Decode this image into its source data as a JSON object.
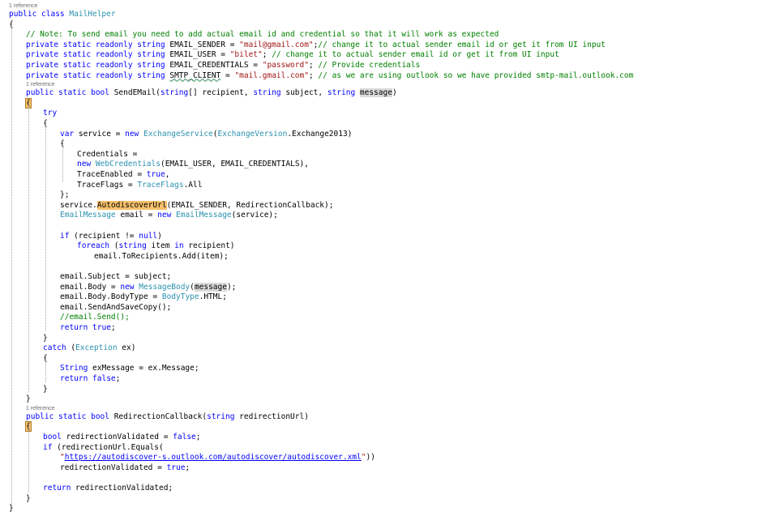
{
  "code": {
    "lines": [
      {
        "kind": "ref",
        "text": "1 reference"
      },
      {
        "kind": "code",
        "indent": 0,
        "tokens": [
          [
            "k",
            "public "
          ],
          [
            "k",
            "class "
          ],
          [
            "t",
            "MailHelper"
          ]
        ]
      },
      {
        "kind": "code",
        "indent": 0,
        "tokens": [
          [
            "p",
            "{"
          ]
        ]
      },
      {
        "kind": "code",
        "indent": 1,
        "tokens": [
          [
            "c",
            "// Note: To send email you need to add actual email id and credential so that it will work as expected"
          ]
        ]
      },
      {
        "kind": "code",
        "indent": 1,
        "tokens": [
          [
            "k",
            "private "
          ],
          [
            "k",
            "static "
          ],
          [
            "k",
            "readonly "
          ],
          [
            "k",
            "string "
          ],
          [
            "p",
            "EMAIL_SENDER = "
          ],
          [
            "s",
            "\"mail@gmail.com\""
          ],
          [
            "p",
            ";"
          ],
          [
            "c",
            "// change it to actual sender email id or get it from UI input"
          ]
        ]
      },
      {
        "kind": "code",
        "indent": 1,
        "tokens": [
          [
            "k",
            "private "
          ],
          [
            "k",
            "static "
          ],
          [
            "k",
            "readonly "
          ],
          [
            "k",
            "string "
          ],
          [
            "p",
            "EMAIL_USER = "
          ],
          [
            "s",
            "\"bilet\""
          ],
          [
            "p",
            "; "
          ],
          [
            "c",
            "// change it to actual sender email id or get it from UI input"
          ]
        ]
      },
      {
        "kind": "code",
        "indent": 1,
        "tokens": [
          [
            "k",
            "private "
          ],
          [
            "k",
            "static "
          ],
          [
            "k",
            "readonly "
          ],
          [
            "k",
            "string "
          ],
          [
            "p",
            "EMAIL_CREDENTIALS = "
          ],
          [
            "s",
            "\"password\""
          ],
          [
            "p",
            "; "
          ],
          [
            "c",
            "// Provide credentials"
          ]
        ]
      },
      {
        "kind": "code",
        "indent": 1,
        "tokens": [
          [
            "k",
            "private "
          ],
          [
            "k",
            "static "
          ],
          [
            "k",
            "readonly "
          ],
          [
            "k",
            "string "
          ],
          [
            "sq",
            "SMTP_CLIENT"
          ],
          [
            "p",
            " = "
          ],
          [
            "s",
            "\"mail.gmail.com\""
          ],
          [
            "p",
            "; "
          ],
          [
            "c",
            "// as we are using outlook so we have provided smtp-mail.outlook.com"
          ]
        ]
      },
      {
        "kind": "ref",
        "text": "1 reference"
      },
      {
        "kind": "code",
        "indent": 1,
        "tokens": [
          [
            "k",
            "public "
          ],
          [
            "k",
            "static "
          ],
          [
            "k",
            "bool "
          ],
          [
            "p",
            "SendEMail("
          ],
          [
            "k",
            "string"
          ],
          [
            "p",
            "[] recipient, "
          ],
          [
            "k",
            "string "
          ],
          [
            "p",
            "subject, "
          ],
          [
            "k",
            "string "
          ],
          [
            "rc",
            "message"
          ],
          [
            "p",
            ")"
          ]
        ]
      },
      {
        "kind": "code",
        "indent": 1,
        "tokens": [
          [
            "bh",
            "{"
          ]
        ]
      },
      {
        "kind": "code",
        "indent": 2,
        "tokens": [
          [
            "k",
            "try"
          ]
        ]
      },
      {
        "kind": "code",
        "indent": 2,
        "tokens": [
          [
            "p",
            "{"
          ]
        ]
      },
      {
        "kind": "code",
        "indent": 3,
        "tokens": [
          [
            "k",
            "var "
          ],
          [
            "p",
            "service = "
          ],
          [
            "k",
            "new "
          ],
          [
            "t",
            "ExchangeService"
          ],
          [
            "p",
            "("
          ],
          [
            "t",
            "ExchangeVersion"
          ],
          [
            "p",
            ".Exchange2013)"
          ]
        ]
      },
      {
        "kind": "code",
        "indent": 3,
        "tokens": [
          [
            "p",
            "{"
          ]
        ]
      },
      {
        "kind": "code",
        "indent": 4,
        "tokens": [
          [
            "p",
            "Credentials ="
          ]
        ]
      },
      {
        "kind": "code",
        "indent": 4,
        "tokens": [
          [
            "k",
            "new "
          ],
          [
            "t",
            "WebCredentials"
          ],
          [
            "p",
            "(EMAIL_USER, EMAIL_CREDENTIALS),"
          ]
        ]
      },
      {
        "kind": "code",
        "indent": 4,
        "tokens": [
          [
            "p",
            "TraceEnabled = "
          ],
          [
            "k",
            "true"
          ],
          [
            "p",
            ","
          ]
        ]
      },
      {
        "kind": "code",
        "indent": 4,
        "tokens": [
          [
            "p",
            "TraceFlags = "
          ],
          [
            "t",
            "TraceFlags"
          ],
          [
            "p",
            ".All"
          ]
        ]
      },
      {
        "kind": "code",
        "indent": 3,
        "tokens": [
          [
            "p",
            "};"
          ]
        ]
      },
      {
        "kind": "code",
        "indent": 3,
        "tokens": [
          [
            "p",
            "service."
          ],
          [
            "hm",
            "AutodiscoverUrl"
          ],
          [
            "p",
            "(EMAIL_SENDER, RedirectionCallback);"
          ]
        ]
      },
      {
        "kind": "code",
        "indent": 3,
        "tokens": [
          [
            "t",
            "EmailMessage "
          ],
          [
            "p",
            "email = "
          ],
          [
            "k",
            "new "
          ],
          [
            "t",
            "EmailMessage"
          ],
          [
            "p",
            "(service);"
          ]
        ]
      },
      {
        "kind": "blank"
      },
      {
        "kind": "code",
        "indent": 3,
        "tokens": [
          [
            "k",
            "if "
          ],
          [
            "p",
            "(recipient != "
          ],
          [
            "k",
            "null"
          ],
          [
            "p",
            ")"
          ]
        ]
      },
      {
        "kind": "code",
        "indent": 4,
        "tokens": [
          [
            "k",
            "foreach "
          ],
          [
            "p",
            "("
          ],
          [
            "k",
            "string "
          ],
          [
            "p",
            "item "
          ],
          [
            "k",
            "in "
          ],
          [
            "p",
            "recipient)"
          ]
        ]
      },
      {
        "kind": "code",
        "indent": 5,
        "tokens": [
          [
            "p",
            "email.ToRecipients.Add(item);"
          ]
        ]
      },
      {
        "kind": "blank"
      },
      {
        "kind": "code",
        "indent": 3,
        "tokens": [
          [
            "p",
            "email.Subject = subject;"
          ]
        ]
      },
      {
        "kind": "code",
        "indent": 3,
        "tokens": [
          [
            "p",
            "email.Body = "
          ],
          [
            "k",
            "new "
          ],
          [
            "t",
            "MessageBody"
          ],
          [
            "p",
            "("
          ],
          [
            "hr",
            "message"
          ],
          [
            "p",
            ");"
          ]
        ]
      },
      {
        "kind": "code",
        "indent": 3,
        "tokens": [
          [
            "p",
            "email.Body.BodyType = "
          ],
          [
            "t",
            "BodyType"
          ],
          [
            "p",
            ".HTML;"
          ]
        ]
      },
      {
        "kind": "code",
        "indent": 3,
        "tokens": [
          [
            "p",
            "email.SendAndSaveCopy();"
          ]
        ]
      },
      {
        "kind": "code",
        "indent": 3,
        "tokens": [
          [
            "c",
            "//email.Send();"
          ]
        ]
      },
      {
        "kind": "code",
        "indent": 3,
        "tokens": [
          [
            "k",
            "return "
          ],
          [
            "k",
            "true"
          ],
          [
            "p",
            ";"
          ]
        ]
      },
      {
        "kind": "code",
        "indent": 2,
        "tokens": [
          [
            "p",
            "}"
          ]
        ]
      },
      {
        "kind": "code",
        "indent": 2,
        "tokens": [
          [
            "k",
            "catch "
          ],
          [
            "p",
            "("
          ],
          [
            "t",
            "Exception "
          ],
          [
            "p",
            "ex)"
          ]
        ]
      },
      {
        "kind": "code",
        "indent": 2,
        "tokens": [
          [
            "p",
            "{"
          ]
        ]
      },
      {
        "kind": "code",
        "indent": 3,
        "tokens": [
          [
            "k",
            "String "
          ],
          [
            "p",
            "exMessage = ex.Message;"
          ]
        ]
      },
      {
        "kind": "code",
        "indent": 3,
        "tokens": [
          [
            "k",
            "return "
          ],
          [
            "k",
            "false"
          ],
          [
            "p",
            ";"
          ]
        ]
      },
      {
        "kind": "code",
        "indent": 2,
        "tokens": [
          [
            "p",
            "}"
          ]
        ]
      },
      {
        "kind": "code",
        "indent": 1,
        "tokens": [
          [
            "p",
            "}"
          ]
        ]
      },
      {
        "kind": "ref",
        "text": "1 reference"
      },
      {
        "kind": "code",
        "indent": 1,
        "tokens": [
          [
            "k",
            "public "
          ],
          [
            "k",
            "static "
          ],
          [
            "k",
            "bool "
          ],
          [
            "p",
            "RedirectionCallback("
          ],
          [
            "k",
            "string "
          ],
          [
            "p",
            "redirectionUrl)"
          ]
        ]
      },
      {
        "kind": "code",
        "indent": 1,
        "tokens": [
          [
            "bh",
            "{"
          ]
        ]
      },
      {
        "kind": "code",
        "indent": 2,
        "tokens": [
          [
            "k",
            "bool "
          ],
          [
            "p",
            "redirectionValidated = "
          ],
          [
            "k",
            "false"
          ],
          [
            "p",
            ";"
          ]
        ]
      },
      {
        "kind": "code",
        "indent": 2,
        "tokens": [
          [
            "k",
            "if "
          ],
          [
            "p",
            "(redirectionUrl.Equals("
          ]
        ]
      },
      {
        "kind": "code",
        "indent": 3,
        "tokens": [
          [
            "s",
            "\""
          ],
          [
            "u",
            "https://autodiscover-s.outlook.com/autodiscover/autodiscover.xml"
          ],
          [
            "s",
            "\""
          ],
          [
            "p",
            "))"
          ]
        ]
      },
      {
        "kind": "code",
        "indent": 3,
        "tokens": [
          [
            "p",
            "redirectionValidated = "
          ],
          [
            "k",
            "true"
          ],
          [
            "p",
            ";"
          ]
        ]
      },
      {
        "kind": "blank"
      },
      {
        "kind": "code",
        "indent": 2,
        "tokens": [
          [
            "k",
            "return "
          ],
          [
            "p",
            "redirectionValidated;"
          ]
        ]
      },
      {
        "kind": "code",
        "indent": 1,
        "tokens": [
          [
            "p",
            "}"
          ]
        ]
      },
      {
        "kind": "code",
        "indent": 0,
        "tokens": [
          [
            "p",
            "}"
          ]
        ]
      }
    ]
  }
}
